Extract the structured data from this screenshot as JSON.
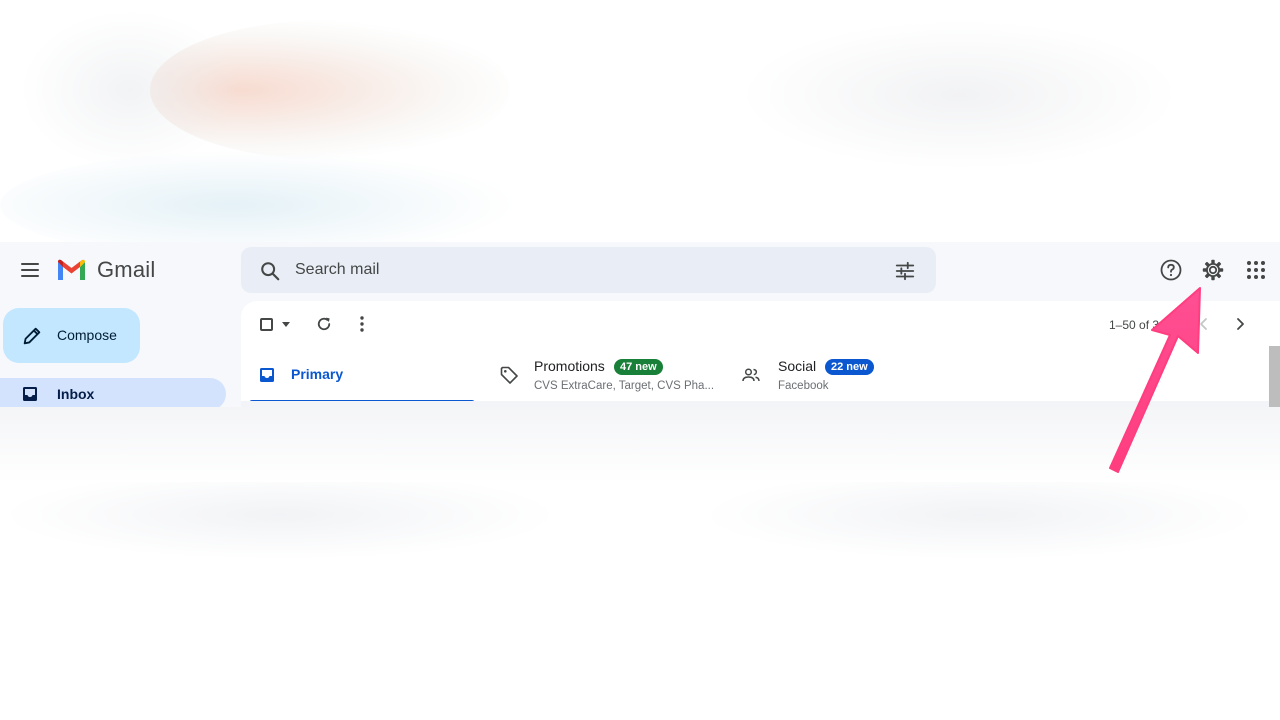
{
  "app": {
    "brand": "Gmail"
  },
  "search": {
    "placeholder": "Search mail"
  },
  "compose": {
    "label": "Compose"
  },
  "nav": {
    "inbox_label": "Inbox"
  },
  "toolbar": {
    "count_text": "1–50 of 3"
  },
  "tabs": [
    {
      "label": "Primary"
    },
    {
      "label": "Promotions",
      "badge": "47 new",
      "subtitle": "CVS ExtraCare, Target, CVS Pha..."
    },
    {
      "label": "Social",
      "badge": "22 new",
      "subtitle": "Facebook"
    }
  ],
  "icons": {
    "menu": "hamburger-menu-icon",
    "search": "search-icon",
    "tune": "tune-icon",
    "help": "help-icon",
    "settings": "gear-icon",
    "apps": "apps-grid-icon",
    "compose": "pencil-icon",
    "inbox": "inbox-icon",
    "refresh": "refresh-icon",
    "more": "more-vert-icon",
    "prev": "chevron-left-icon",
    "next": "chevron-right-icon",
    "promotions": "tag-icon",
    "social": "people-icon"
  },
  "colors": {
    "accent": "#0b57d0",
    "compose_bg": "#c2e7ff",
    "nav_active_bg": "#d3e3fd",
    "promo_badge": "#188038",
    "social_badge": "#0b57d0",
    "annotation_arrow": "#ff4081"
  }
}
